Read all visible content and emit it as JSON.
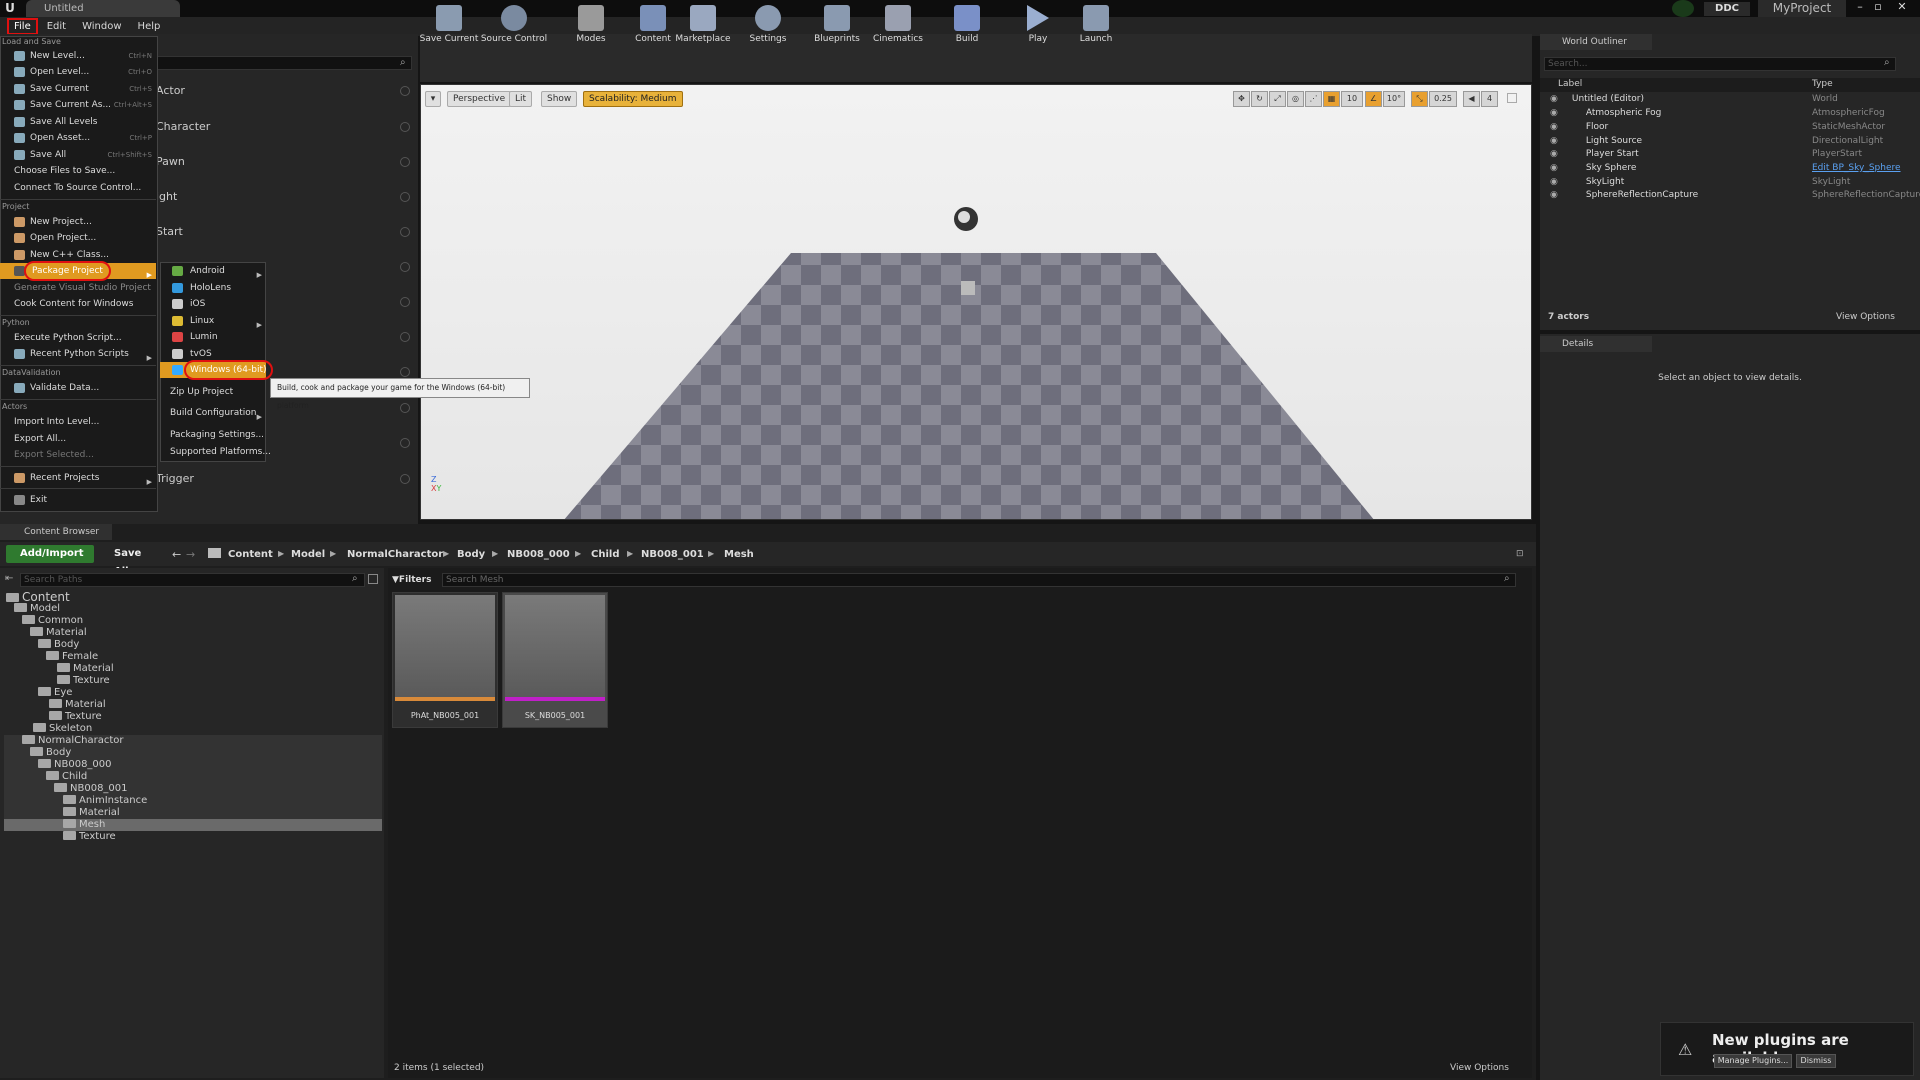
{
  "window": {
    "title": "Untitled",
    "ddc": "DDC",
    "project": "MyProject"
  },
  "menubar": [
    "File",
    "Edit",
    "Window",
    "Help"
  ],
  "toolbar": [
    "Save Current",
    "Source Control",
    "Modes",
    "Content",
    "Marketplace",
    "Settings",
    "Blueprints",
    "Cinematics",
    "Build",
    "Play",
    "Launch"
  ],
  "modes": {
    "items": [
      "Actor",
      "Character",
      "Pawn",
      "ight",
      "Start",
      "Trigger"
    ]
  },
  "viewport": {
    "perspective": "Perspective",
    "lit": "Lit",
    "show": "Show",
    "scalability": "Scalability: Medium",
    "grid": "10",
    "angle": "10°",
    "scale": "0.25",
    "speed": "4"
  },
  "file_menu": {
    "load_save_header": "Load and Save",
    "new_level": "New Level...",
    "new_level_sc": "Ctrl+N",
    "open_level": "Open Level...",
    "open_level_sc": "Ctrl+O",
    "save_current": "Save Current",
    "save_current_sc": "Ctrl+S",
    "save_current_as": "Save Current As...",
    "save_current_as_sc": "Ctrl+Alt+S",
    "save_all_levels": "Save All Levels",
    "open_asset": "Open Asset...",
    "open_asset_sc": "Ctrl+P",
    "save_all": "Save All",
    "save_all_sc": "Ctrl+Shift+S",
    "choose_files": "Choose Files to Save...",
    "connect_source": "Connect To Source Control...",
    "project_header": "Project",
    "new_project": "New Project...",
    "open_project": "Open Project...",
    "new_cpp": "New C++ Class...",
    "package_project": "Package Project",
    "generate_vs": "Generate Visual Studio Project",
    "cook_windows": "Cook Content for Windows",
    "python_header": "Python",
    "execute_python": "Execute Python Script...",
    "recent_python": "Recent Python Scripts",
    "datavalidation_header": "DataValidation",
    "validate_data": "Validate Data...",
    "actors_header": "Actors",
    "import_level": "Import Into Level...",
    "export_all": "Export All...",
    "export_selected": "Export Selected...",
    "recent_projects": "Recent Projects",
    "exit": "Exit"
  },
  "package_menu": {
    "android": "Android",
    "hololens": "HoloLens",
    "ios": "iOS",
    "linux": "Linux",
    "lumin": "Lumin",
    "tvos": "tvOS",
    "windows": "Windows (64-bit)",
    "zip": "Zip Up Project",
    "build_config": "Build Configuration",
    "packaging_settings": "Packaging Settings...",
    "supported": "Supported Platforms..."
  },
  "tooltip": "Build, cook and package your game for the Windows (64-bit) platform",
  "content_browser": {
    "tab": "Content Browser",
    "add_import": "Add/Import",
    "save_all": "Save All",
    "breadcrumbs": [
      "Content",
      "Model",
      "NormalCharactor",
      "Body",
      "NB008_000",
      "Child",
      "NB008_001",
      "Mesh"
    ],
    "search_paths": "Search Paths",
    "filters": "Filters",
    "search_mesh": "Search Mesh",
    "tree": [
      "Content",
      "Model",
      "Common",
      "Material",
      "Body",
      "Female",
      "Material",
      "Texture",
      "Eye",
      "Material",
      "Texture",
      "Skeleton",
      "NormalCharactor",
      "Body",
      "NB008_000",
      "Child",
      "NB008_001",
      "AnimInstance",
      "Material",
      "Mesh",
      "Texture"
    ],
    "assets": [
      {
        "name": "PhAt_NB005_001",
        "color": "#d88a3a"
      },
      {
        "name": "SK_NB005_001",
        "color": "#c020c8"
      }
    ],
    "status": "2 items (1 selected)",
    "view_options": "View Options"
  },
  "outliner": {
    "tab": "World Outliner",
    "search": "Search...",
    "col_label": "Label",
    "col_type": "Type",
    "rows": [
      {
        "label": "Untitled (Editor)",
        "type": "World"
      },
      {
        "label": "Atmospheric Fog",
        "type": "AtmosphericFog"
      },
      {
        "label": "Floor",
        "type": "StaticMeshActor"
      },
      {
        "label": "Light Source",
        "type": "DirectionalLight"
      },
      {
        "label": "Player Start",
        "type": "PlayerStart"
      },
      {
        "label": "Sky Sphere",
        "type": "Edit BP_Sky_Sphere"
      },
      {
        "label": "SkyLight",
        "type": "SkyLight"
      },
      {
        "label": "SphereReflectionCapture",
        "type": "SphereReflectionCapture"
      }
    ],
    "count": "7 actors",
    "view_options": "View Options"
  },
  "details": {
    "tab": "Details",
    "empty": "Select an object to view details."
  },
  "notification": {
    "title": "New plugins are available",
    "manage": "Manage Plugins...",
    "dismiss": "Dismiss"
  },
  "colors": {
    "accent_red": "#e01010",
    "add_green": "#2f7a2f",
    "scalability": "#e8b23a"
  }
}
